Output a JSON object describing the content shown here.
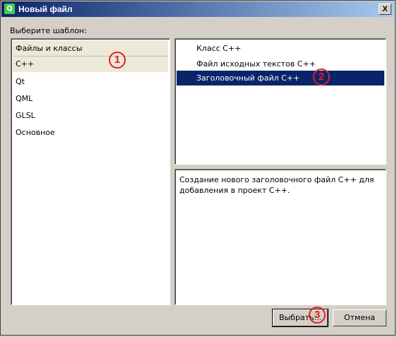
{
  "window": {
    "title": "Новый файл",
    "close_label": "X",
    "app_icon_glyph": "Q"
  },
  "prompt": "Выберите шаблон:",
  "categories": {
    "header": "Файлы и классы",
    "items": [
      "C++",
      "Qt",
      "QML",
      "GLSL",
      "Основное"
    ],
    "selected": "C++"
  },
  "templates": {
    "items": [
      "Класс C++",
      "Файл исходных текстов C++",
      "Заголовочный файл C++"
    ],
    "selected": "Заголовочный файл C++"
  },
  "description": "Создание нового заголовочного файл C++ для добавления в проект C++.",
  "buttons": {
    "select": "Выбрать...",
    "cancel": "Отмена"
  },
  "annotations": {
    "badge1": "1",
    "badge2": "2",
    "badge3": "3",
    "color": "#e0201e"
  }
}
